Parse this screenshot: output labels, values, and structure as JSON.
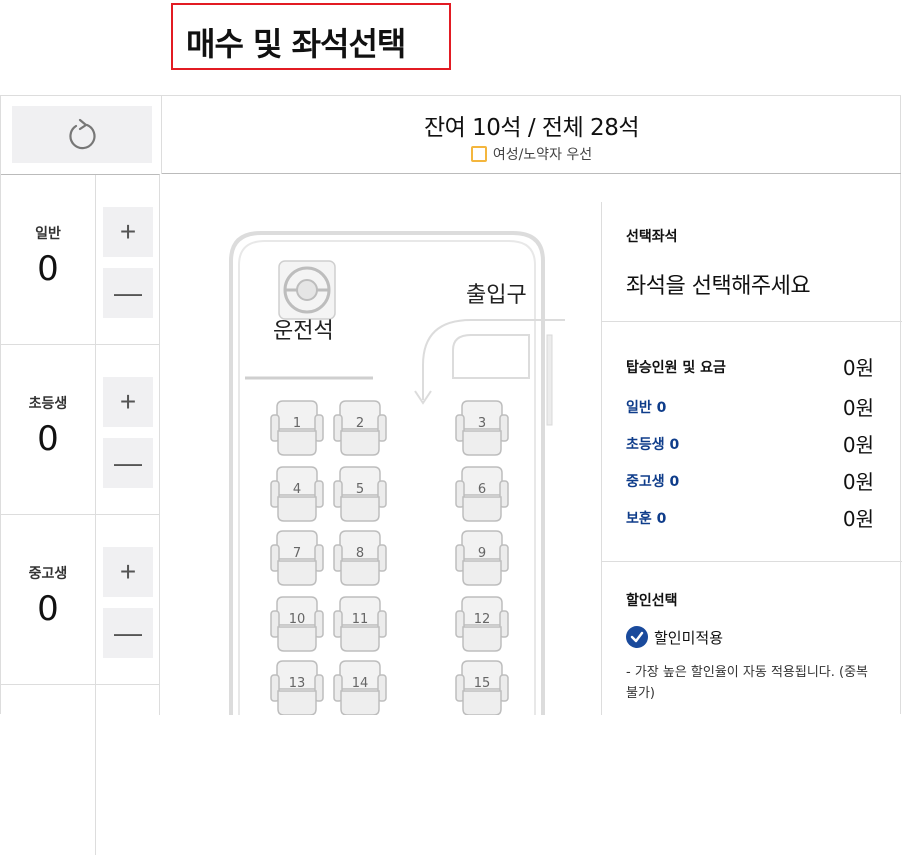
{
  "page_title": "매수 및 좌석선택",
  "summary": {
    "seats_text": "잔여 10석 / 전체 28석",
    "legend_label": "여성/노약자 우선"
  },
  "counters": [
    {
      "label": "일반",
      "count": "0"
    },
    {
      "label": "초등생",
      "count": "0"
    },
    {
      "label": "중고생",
      "count": "0"
    }
  ],
  "bus": {
    "driver_label": "운전석",
    "entrance_label": "출입구",
    "seats": [
      "1",
      "2",
      "3",
      "4",
      "5",
      "6",
      "7",
      "8",
      "9",
      "10",
      "11",
      "12",
      "13",
      "14",
      "15"
    ]
  },
  "selected": {
    "title": "선택좌석",
    "message": "좌석을 선택해주세요"
  },
  "fare": {
    "title": "탑승인원 및 요금",
    "total": "0원",
    "rows": [
      {
        "label": "일반 0",
        "amount": "0원"
      },
      {
        "label": "초등생 0",
        "amount": "0원"
      },
      {
        "label": "중고생 0",
        "amount": "0원"
      },
      {
        "label": "보훈 0",
        "amount": "0원"
      }
    ]
  },
  "discount": {
    "title": "할인선택",
    "option": "할인미적용",
    "note": "- 가장 높은 할인율이 자동 적용됩니다. (중복불가)"
  },
  "colors": {
    "accent": "#1a4a9c",
    "highlight": "#e21b23",
    "legend": "#f4b63d"
  }
}
